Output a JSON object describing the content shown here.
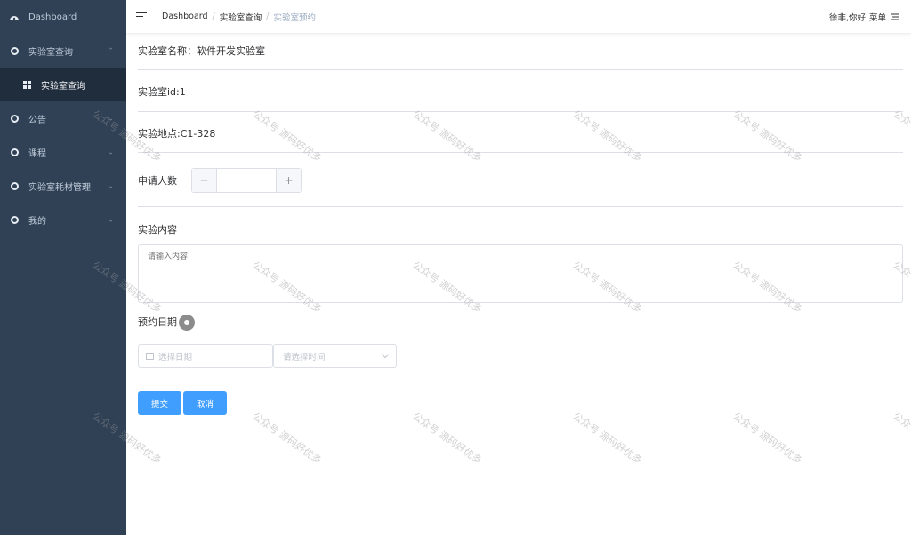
{
  "sidebar": {
    "items": [
      {
        "label": "Dashboard",
        "icon": "dashboard-icon"
      },
      {
        "label": "实验室查询",
        "icon": "circle-icon",
        "chevron": "^"
      },
      {
        "label": "实验室查询",
        "icon": "grid-icon"
      },
      {
        "label": "公告",
        "icon": "circle-icon",
        "chevron": "v"
      },
      {
        "label": "课程",
        "icon": "circle-icon",
        "chevron": "v"
      },
      {
        "label": "实验室耗材管理",
        "icon": "circle-icon",
        "chevron": "v"
      },
      {
        "label": "我的",
        "icon": "circle-icon",
        "chevron": "v"
      }
    ]
  },
  "header": {
    "breadcrumb": [
      "Dashboard",
      "实验室查询",
      "实验室预约"
    ],
    "greeting": "徐非,你好",
    "menu_label": "菜单"
  },
  "form": {
    "lab_name": "实验室名称：软件开发实验室",
    "lab_id": "实验室id:1",
    "lab_location": "实验地点:C1-328",
    "applicants_label": "申请人数",
    "applicants_value": "",
    "content_label": "实验内容",
    "content_placeholder": "请输入内容",
    "date_label": "预约日期",
    "date_placeholder": "选择日期",
    "time_placeholder": "请选择时间",
    "submit_label": "提交",
    "cancel_label": "取消"
  },
  "watermark": "公众号 源码好优多",
  "colors": {
    "sidebar_bg": "#304156",
    "sidebar_active_bg": "#1f2d3d",
    "primary": "#409eff"
  }
}
